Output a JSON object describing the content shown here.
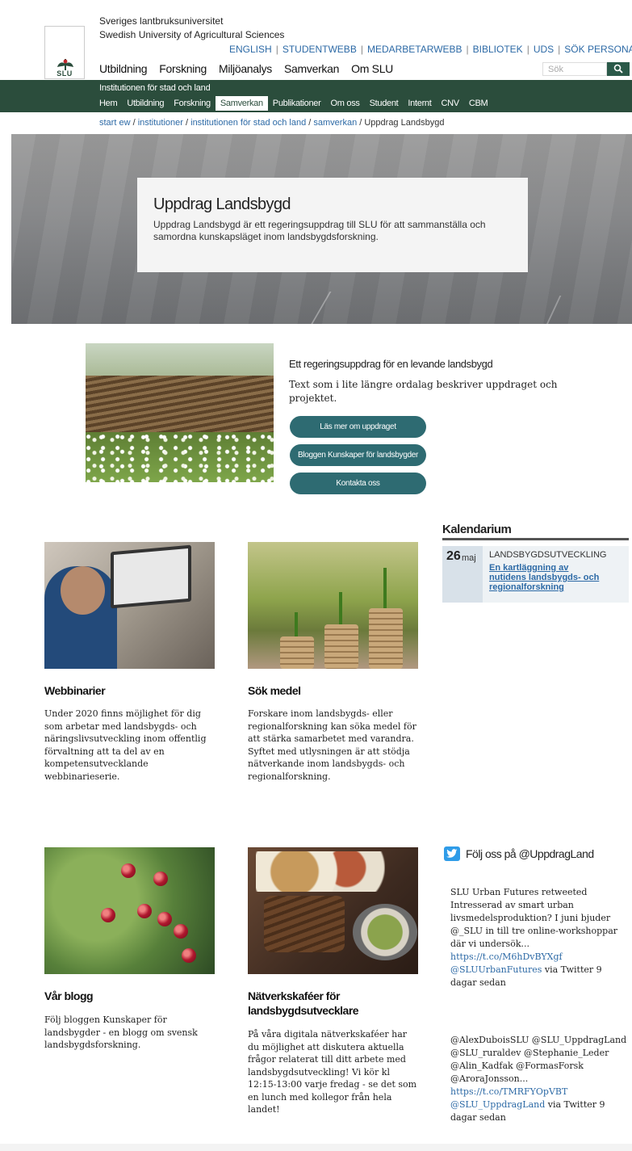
{
  "header": {
    "org_sv": "Sveriges lantbruksuniversitet",
    "org_en": "Swedish University of Agricultural Sciences",
    "logo_text": "SLU",
    "top_links": [
      "ENGLISH",
      "STUDENTWEBB",
      "MEDARBETARWEBB",
      "BIBLIOTEK",
      "UDS",
      "SÖK PERSONAL"
    ],
    "main_nav": [
      "Utbildning",
      "Forskning",
      "Miljöanalys",
      "Samverkan",
      "Om SLU"
    ],
    "search_placeholder": "Sök",
    "search_icon": "magnifier-icon"
  },
  "subheader": {
    "institution": "Institutionen för stad och land",
    "nav": [
      "Hem",
      "Utbildning",
      "Forskning",
      "Samverkan",
      "Publikationer",
      "Om oss",
      "Student",
      "Internt",
      "CNV",
      "CBM"
    ],
    "active": "Samverkan",
    "colors": {
      "bar": "#2b4d3c"
    }
  },
  "breadcrumb": {
    "links": [
      "start ew",
      "institutioner",
      "institutionen för stad och land",
      "samverkan"
    ],
    "current": "Uppdrag Landsbygd"
  },
  "hero": {
    "title": "Uppdrag Landsbygd",
    "text": "Uppdrag Landsbygd är ett regeringsuppdrag till SLU för att sammanställa och samordna kunskapsläget inom landsbygdsforskning."
  },
  "intro": {
    "heading": "Ett regeringsuppdrag för en levande landsbygd",
    "text": "Text som i lite längre ordalag beskriver uppdraget och projektet.",
    "buttons": [
      "Läs mer om uppdraget",
      "Bloggen Kunskaper för landsbygder",
      "Kontakta oss"
    ],
    "button_color": "#2e6b72"
  },
  "calendar": {
    "title": "Kalendarium",
    "day": "26",
    "month": "maj",
    "category": "LANDSBYGDSUTVECKLING",
    "link": "En kartläggning av nutidens landsbygds- och regionalforskning"
  },
  "cards": [
    {
      "title": "Webbinarier",
      "text": "Under 2020 finns möjlighet för dig som arbetar med landsbygds- och näringslivsutveckling inom offentlig förvaltning att ta del av en kompetensutvecklande webbinarieserie."
    },
    {
      "title": "Sök medel",
      "text": "Forskare inom landsbygds- eller regionalforskning kan söka medel för att stärka samarbetet med varandra. Syftet med utlysningen är att stödja nätverkande inom landsbygds- och regionalforskning."
    },
    {
      "title": "Vår blogg",
      "text": "Följ bloggen Kunskaper för landsbygder - en blogg om svensk landsbygdsforskning."
    },
    {
      "title": "Nätverkskaféer för landsbygdsutvecklare",
      "text": "På våra digitala nätverkskaféer har du möjlighet att diskutera aktuella frågor relaterat till ditt arbete med landsbygdsutveckling! Vi kör kl 12:15-13:00 varje fredag - se det som en lunch med kollegor från hela landet!"
    }
  ],
  "twitter": {
    "title": "Följ oss på @UppdragLand",
    "tweets": [
      {
        "text": "SLU Urban Futures retweeted Intresserad av smart urban livsmedelsproduktion? I juni bjuder @_SLU in till tre online-workshoppar där vi undersök...",
        "link": "https://t.co/M6hDvBYXgf",
        "handle": "@SLUUrbanFutures",
        "meta": "via Twitter 9 dagar sedan"
      },
      {
        "text": "@AlexDuboisSLU @SLU_UppdragLand @SLU_ruraldev @Stephanie_Leder @Alin_Kadfak @FormasForsk @AroraJonsson...",
        "link": "https://t.co/TMRFYOpVBT",
        "handle": "@SLU_UppdragLand",
        "meta": "via Twitter 9 dagar sedan"
      }
    ]
  }
}
